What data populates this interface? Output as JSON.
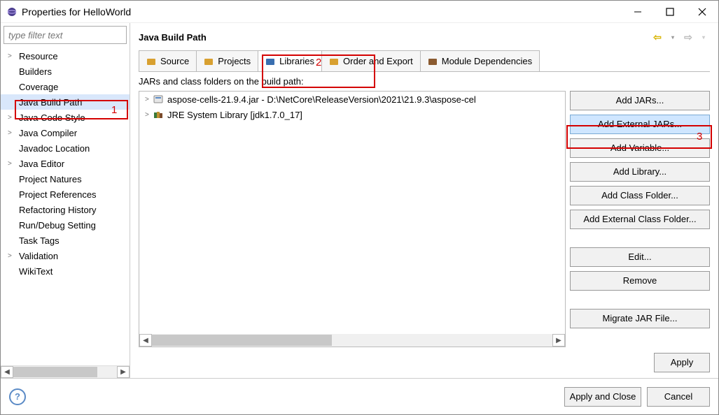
{
  "window": {
    "title": "Properties for HelloWorld"
  },
  "filter": {
    "placeholder": "type filter text"
  },
  "sidebar": {
    "items": [
      {
        "label": "Resource",
        "arrow": true
      },
      {
        "label": "Builders",
        "arrow": false
      },
      {
        "label": "Coverage",
        "arrow": false
      },
      {
        "label": "Java Build Path",
        "arrow": false,
        "selected": true
      },
      {
        "label": "Java Code Style",
        "arrow": true
      },
      {
        "label": "Java Compiler",
        "arrow": true
      },
      {
        "label": "Javadoc Location",
        "arrow": false
      },
      {
        "label": "Java Editor",
        "arrow": true
      },
      {
        "label": "Project Natures",
        "arrow": false
      },
      {
        "label": "Project References",
        "arrow": false
      },
      {
        "label": "Refactoring History",
        "arrow": false
      },
      {
        "label": "Run/Debug Setting",
        "arrow": false
      },
      {
        "label": "Task Tags",
        "arrow": false
      },
      {
        "label": "Validation",
        "arrow": true
      },
      {
        "label": "WikiText",
        "arrow": false
      }
    ]
  },
  "page": {
    "title": "Java Build Path",
    "tabs": [
      {
        "label": "Source"
      },
      {
        "label": "Projects"
      },
      {
        "label": "Libraries",
        "active": true
      },
      {
        "label": "Order and Export"
      },
      {
        "label": "Module Dependencies"
      }
    ],
    "caption": "JARs and class folders on the build path:",
    "entries": [
      {
        "label": "aspose-cells-21.9.4.jar - D:\\NetCore\\ReleaseVersion\\2021\\21.9.3\\aspose-cel",
        "icon": "jar"
      },
      {
        "label": "JRE System Library [jdk1.7.0_17]",
        "icon": "lib"
      }
    ],
    "buttons": {
      "addJars": "Add JARs...",
      "addExternalJars": "Add External JARs...",
      "addVariable": "Add Variable...",
      "addLibrary": "Add Library...",
      "addClassFolder": "Add Class Folder...",
      "addExternalClassFolder": "Add External Class Folder...",
      "edit": "Edit...",
      "remove": "Remove",
      "migrate": "Migrate JAR File..."
    },
    "apply": "Apply"
  },
  "footer": {
    "applyClose": "Apply and Close",
    "cancel": "Cancel"
  },
  "annotations": {
    "n1": "1",
    "n2": "2",
    "n3": "3"
  }
}
